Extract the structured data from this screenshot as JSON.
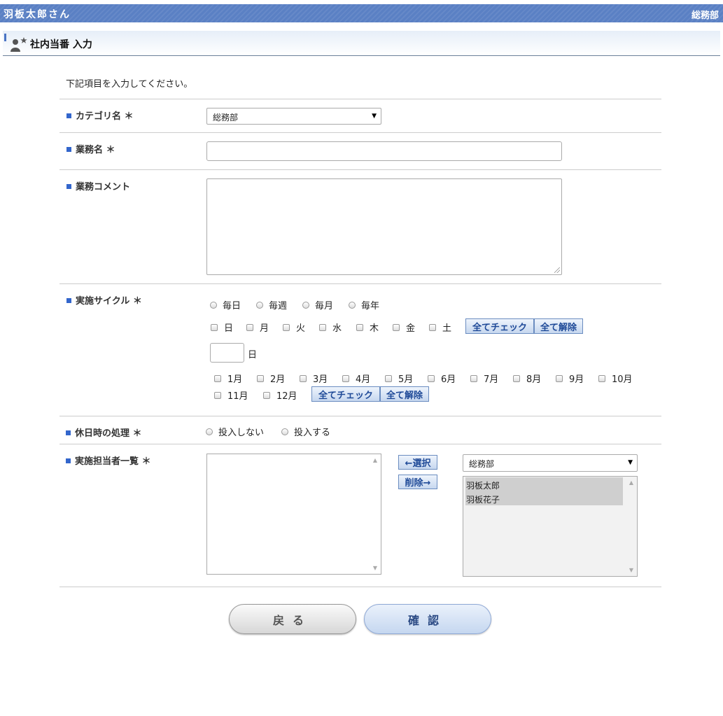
{
  "header": {
    "user": "羽板太郎さん",
    "department": "総務部"
  },
  "page": {
    "title": "社内当番 入力",
    "intro": "下記項目を入力してください。"
  },
  "form": {
    "category": {
      "label": "カテゴリ名 ＊",
      "value": "総務部"
    },
    "task_name": {
      "label": "業務名 ＊",
      "value": ""
    },
    "task_comment": {
      "label": "業務コメント",
      "value": ""
    },
    "cycle": {
      "label": "実施サイクル ＊",
      "options": [
        "毎日",
        "毎週",
        "毎月",
        "毎年"
      ],
      "weekdays": [
        "日",
        "月",
        "火",
        "水",
        "木",
        "金",
        "土"
      ],
      "check_all": "全てチェック",
      "clear_all": "全て解除",
      "day_value": "",
      "day_unit": "日",
      "months": [
        "1月",
        "2月",
        "3月",
        "4月",
        "5月",
        "6月",
        "7月",
        "8月",
        "9月",
        "10月",
        "11月",
        "12月"
      ]
    },
    "holiday": {
      "label": "休日時の処理 ＊",
      "options": [
        "投入しない",
        "投入する"
      ]
    },
    "assignees": {
      "label": "実施担当者一覧 ＊",
      "select_button": "←選択",
      "remove_button": "削除→",
      "group_value": "総務部",
      "candidates": [
        "羽板太郎",
        "羽板花子"
      ]
    }
  },
  "buttons": {
    "back": "戻る",
    "confirm": "確認"
  },
  "colors": {
    "header_bg": "#5a80c4",
    "accent": "#3366cc",
    "button_text": "#1f4a98"
  }
}
